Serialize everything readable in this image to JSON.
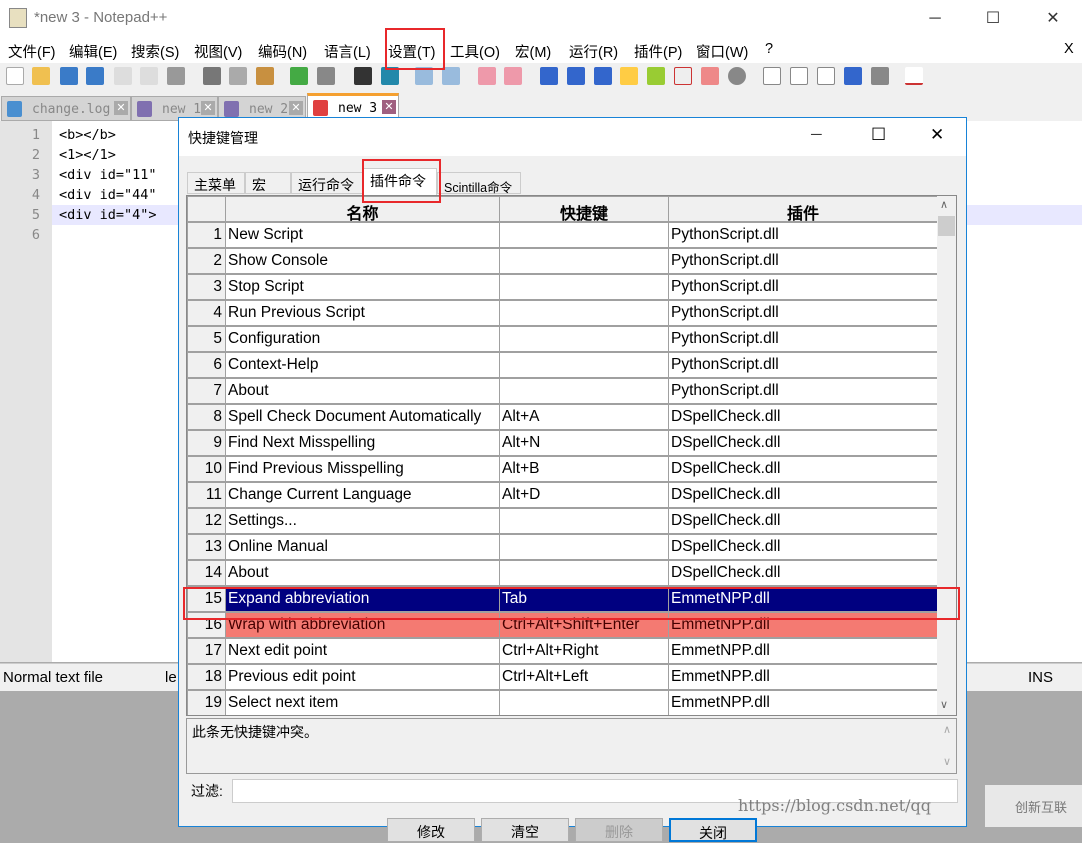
{
  "window": {
    "title": "*new 3 - Notepad++",
    "minimize": "─",
    "maximize": "☐",
    "close": "✕"
  },
  "menu": [
    "文件(F)",
    "编辑(E)",
    "搜索(S)",
    "视图(V)",
    "编码(N)",
    "语言(L)",
    "设置(T)",
    "工具(O)",
    "宏(M)",
    "运行(R)",
    "插件(P)",
    "窗口(W)",
    "?"
  ],
  "menu_close": "X",
  "file_tabs": [
    {
      "label": "change.log",
      "active": false
    },
    {
      "label": "new 1",
      "active": false
    },
    {
      "label": "new 2",
      "active": false
    },
    {
      "label": "new 3",
      "active": true
    }
  ],
  "editor": {
    "lines": [
      {
        "n": "1",
        "text": "<b></b>"
      },
      {
        "n": "2",
        "text": "<1></1>"
      },
      {
        "n": "3",
        "text": "<div id=\"11\""
      },
      {
        "n": "4",
        "text": "<div id=\"44\""
      },
      {
        "n": "5",
        "text": "<div id=\"4\">"
      },
      {
        "n": "6",
        "text": ""
      }
    ]
  },
  "status": {
    "type": "Normal text file",
    "mid": "le",
    "mode": "INS"
  },
  "dialog": {
    "title": "快捷键管理",
    "tabs": [
      "主菜单",
      "宏",
      "运行命令",
      "插件命令",
      "Scintilla命令"
    ],
    "active_tab": "插件命令",
    "columns": [
      "名称",
      "快捷键",
      "插件"
    ],
    "rows": [
      [
        "1",
        "New Script",
        "",
        "PythonScript.dll"
      ],
      [
        "2",
        "Show Console",
        "",
        "PythonScript.dll"
      ],
      [
        "3",
        "Stop Script",
        "",
        "PythonScript.dll"
      ],
      [
        "4",
        "Run Previous Script",
        "",
        "PythonScript.dll"
      ],
      [
        "5",
        "Configuration",
        "",
        "PythonScript.dll"
      ],
      [
        "6",
        "Context-Help",
        "",
        "PythonScript.dll"
      ],
      [
        "7",
        "About",
        "",
        "PythonScript.dll"
      ],
      [
        "8",
        "Spell Check Document Automatically",
        "Alt+A",
        "DSpellCheck.dll"
      ],
      [
        "9",
        "Find Next Misspelling",
        "Alt+N",
        "DSpellCheck.dll"
      ],
      [
        "10",
        "Find Previous Misspelling",
        "Alt+B",
        "DSpellCheck.dll"
      ],
      [
        "11",
        "Change Current Language",
        "Alt+D",
        "DSpellCheck.dll"
      ],
      [
        "12",
        "Settings...",
        "",
        "DSpellCheck.dll"
      ],
      [
        "13",
        "Online Manual",
        "",
        "DSpellCheck.dll"
      ],
      [
        "14",
        "About",
        "",
        "DSpellCheck.dll"
      ],
      [
        "15",
        "Expand abbreviation",
        "Tab",
        "EmmetNPP.dll"
      ],
      [
        "16",
        "Wrap with abbreviation",
        "Ctrl+Alt+Shift+Enter",
        "EmmetNPP.dll"
      ],
      [
        "17",
        "Next edit point",
        "Ctrl+Alt+Right",
        "EmmetNPP.dll"
      ],
      [
        "18",
        "Previous edit point",
        "Ctrl+Alt+Left",
        "EmmetNPP.dll"
      ],
      [
        "19",
        "Select next item",
        "",
        "EmmetNPP.dll"
      ]
    ],
    "selected_row": "15",
    "conflict_row": "16",
    "conflict_message": "此条无快捷键冲突。",
    "filter_label": "过滤:",
    "filter_value": "",
    "buttons": [
      "修改",
      "清空",
      "删除",
      "关闭"
    ]
  },
  "watermark": "https://blog.csdn.net/qq",
  "logo_text": "创新互联",
  "colors": {
    "selected": "#000080",
    "conflict": "#f47a72",
    "highlight": "#e8282b"
  }
}
